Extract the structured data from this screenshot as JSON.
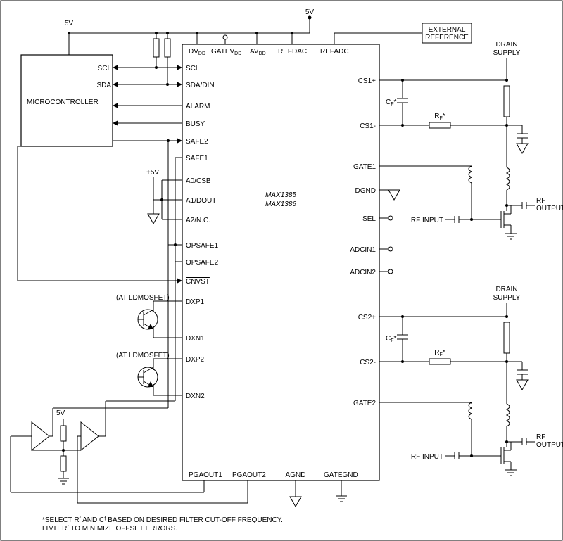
{
  "supply": {
    "v5_left": "5V",
    "v5_top": "5V",
    "v5_mcu": "+5V",
    "v5_comp": "5V"
  },
  "blocks": {
    "mcu": "MICROCONTROLLER",
    "extref1": "EXTERNAL",
    "extref2": "REFERENCE",
    "drain1": "DRAIN",
    "drain1b": "SUPPLY",
    "drain2": "DRAIN",
    "drain2b": "SUPPLY"
  },
  "mcu_pins": {
    "scl": "SCL",
    "sda": "SDA"
  },
  "chip": {
    "name1": "MAX1385",
    "name2": "MAX1386",
    "top": {
      "dvdd": "DV",
      "dvdd_sub": "DD",
      "gatevdd": "GATEV",
      "gatevdd_sub": "DD",
      "avdd": "AV",
      "avdd_sub": "DD",
      "refdac": "REFDAC",
      "refadc": "REFADC"
    },
    "left": {
      "scl": "SCL",
      "sda": "SDA/DIN",
      "alarm": "ALARM",
      "busy": "BUSY",
      "safe2": "SAFE2",
      "safe1": "SAFE1",
      "a0": "A0/CSB",
      "a1": "A1/DOUT",
      "a2": "A2/N.C.",
      "opsafe1": "OPSAFE1",
      "opsafe2": "OPSAFE2",
      "cnvst": "CNVST",
      "dxp1": "DXP1",
      "dxn1": "DXN1",
      "dxp2": "DXP2",
      "dxn2": "DXN2"
    },
    "right": {
      "cs1p": "CS1+",
      "cs1n": "CS1-",
      "gate1": "GATE1",
      "dgnd": "DGND",
      "sel": "SEL",
      "adcin1": "ADCIN1",
      "adcin2": "ADCIN2",
      "cs2p": "CS2+",
      "cs2n": "CS2-",
      "gate2": "GATE2"
    },
    "bottom": {
      "pgaout1": "PGAOUT1",
      "pgaout2": "PGAOUT2",
      "agnd": "AGND",
      "gategnd": "GATEGND"
    }
  },
  "annot": {
    "cf": "C",
    "cf_sub": "F",
    "cf_star": "*",
    "rf": "R",
    "rf_sub": "F",
    "rf_star": "*",
    "rf_input": "RF INPUT",
    "rf_output1": "RF",
    "rf_output2": "OUTPUT",
    "ldmos": "(AT LDMOSFET)",
    "overbar_a0": "CSB",
    "overbar_cnvst": "CNVST"
  },
  "footnote": {
    "line1": "*SELECT Rᶠ AND Cᶠ BASED ON DESIRED FILTER CUT-OFF FREQUENCY.",
    "line2": "LIMIT Rᶠ TO MINIMIZE OFFSET ERRORS."
  }
}
